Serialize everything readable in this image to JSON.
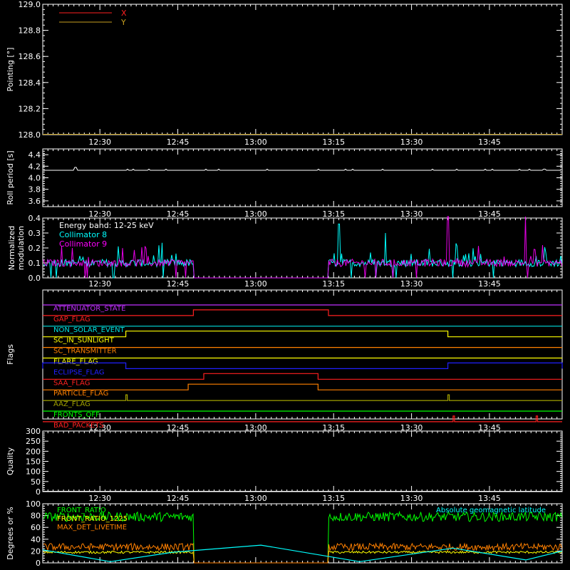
{
  "chart_data": [
    {
      "type": "line",
      "ylabel": "Pointing [°]",
      "ylim": [
        128.0,
        129.0
      ],
      "yticks": [
        "128.0",
        "128.2",
        "128.4",
        "128.6",
        "128.8",
        "129.0"
      ],
      "legend": {
        "placement": "top-left",
        "entries": [
          {
            "name": "X",
            "color": "#ff2020"
          },
          {
            "name": "Y",
            "color": "#c8a020"
          }
        ]
      },
      "series": [
        {
          "name": "X",
          "color": "#ff2020",
          "constant": 128.0
        },
        {
          "name": "Y",
          "color": "#c8a020",
          "constant": 128.0
        }
      ]
    },
    {
      "type": "line",
      "ylabel": "Roll period [s]",
      "ylim": [
        3.5,
        4.5
      ],
      "yticks": [
        "3.6",
        "3.8",
        "4.0",
        "4.2",
        "4.4"
      ],
      "series": [
        {
          "name": "",
          "color": "#ffffff",
          "constant": 4.13
        }
      ]
    },
    {
      "type": "line",
      "ylabel": [
        "Normalized",
        "modulation"
      ],
      "ylim": [
        0.0,
        0.4
      ],
      "yticks": [
        "0.0",
        "0.1",
        "0.2",
        "0.3",
        "0.4"
      ],
      "annotation": "Energy band: 12-25 keV",
      "legend": {
        "placement": "top-left",
        "entries": [
          {
            "name": "Collimator 8",
            "color": "#00ffff"
          },
          {
            "name": "Collimator 9",
            "color": "#ff00ff"
          }
        ]
      },
      "data_gap": [
        "12:48",
        "13:14"
      ],
      "series": [
        {
          "name": "Collimator 8",
          "color": "#00ffff",
          "baseline": 0.1,
          "spikes": [
            {
              "t": "13:16",
              "y": 0.36
            },
            {
              "t": "13:25",
              "y": 0.3
            }
          ]
        },
        {
          "name": "Collimator 9",
          "color": "#ff00ff",
          "baseline": 0.1,
          "spikes": [
            {
              "t": "13:37",
              "y": 0.41
            },
            {
              "t": "13:52",
              "y": 0.41
            }
          ]
        }
      ]
    },
    {
      "type": "line",
      "ylabel": "Flags",
      "flags": [
        {
          "name": "ATTENUATOR_STATE",
          "color": "#c030ff",
          "high": []
        },
        {
          "name": "GAP_FLAG",
          "color": "#ff2020",
          "high": [
            [
              "12:48",
              "13:14"
            ]
          ]
        },
        {
          "name": "NON_SOLAR_EVENT",
          "color": "#00e0e0",
          "high": []
        },
        {
          "name": "SC_IN_SUNLIGHT",
          "color": "#ffff00",
          "high": [
            [
              "12:35",
              "13:37"
            ]
          ]
        },
        {
          "name": "SC_TRANSMITTER",
          "color": "#ff8000",
          "high": []
        },
        {
          "name": "FLARE_FLAG",
          "color": "#ffff00",
          "high": []
        },
        {
          "name": "ECLIPSE_FLAG",
          "color": "#2020ff",
          "high": [
            [
              "12:19",
              "12:35"
            ],
            [
              "13:37",
              "13:59"
            ]
          ]
        },
        {
          "name": "SAA_FLAG",
          "color": "#ff2020",
          "high": [
            [
              "12:50",
              "13:12"
            ]
          ]
        },
        {
          "name": "PARTICLE_FLAG",
          "color": "#ff8000",
          "high": [
            [
              "12:47",
              "13:12"
            ]
          ]
        },
        {
          "name": "AAZ_FLAG",
          "color": "#a0a000",
          "high": [
            [
              "12:35",
              "12:35"
            ],
            [
              "13:37",
              "13:37"
            ]
          ]
        },
        {
          "name": "FRONTS_OFF",
          "color": "#00ff00",
          "high": []
        },
        {
          "name": "BAD_PACKETS",
          "color": "#ff2020",
          "high": [
            [
              "13:38",
              "13:38"
            ],
            [
              "13:54",
              "13:54"
            ]
          ]
        }
      ]
    },
    {
      "type": "line",
      "ylabel": "Quality",
      "ylim": [
        0,
        300
      ],
      "yticks": [
        "0",
        "50",
        "100",
        "150",
        "200",
        "250",
        "300"
      ],
      "series": [
        {
          "name": "",
          "color": "#ffffff",
          "constant": 0
        }
      ]
    },
    {
      "type": "line",
      "ylabel": "Degrees or %",
      "ylim": [
        0,
        100
      ],
      "yticks": [
        "0",
        "20",
        "40",
        "60",
        "80",
        "100"
      ],
      "legend": {
        "placement": "top",
        "entries": [
          {
            "name": "FRONT_RATIO",
            "color": "#00ff00"
          },
          {
            "name": "FRONT_RATIO_1225",
            "color": "#ffff00"
          },
          {
            "name": "MAX_DET_LIVETIME",
            "color": "#ff8000"
          },
          {
            "name": "Absolute geomagnetic latitude",
            "color": "#00ffff"
          }
        ]
      },
      "data_gap": [
        "12:48",
        "13:14"
      ],
      "series": [
        {
          "name": "FRONT_RATIO",
          "color": "#00ff00",
          "level": 78
        },
        {
          "name": "FRONT_RATIO_1225",
          "color": "#ffff00",
          "level": 18
        },
        {
          "name": "MAX_DET_LIVETIME",
          "color": "#ff8000",
          "level": 27
        },
        {
          "name": "Absolute geomagnetic latitude",
          "color": "#00ffff",
          "points": [
            [
              "12:19",
              22
            ],
            [
              "12:32",
              2
            ],
            [
              "12:44",
              18
            ],
            [
              "13:01",
              30
            ],
            [
              "13:20",
              2
            ],
            [
              "13:38",
              25
            ],
            [
              "13:52",
              5
            ],
            [
              "13:59",
              20
            ]
          ]
        }
      ]
    }
  ],
  "time_axis": {
    "start": "12:19",
    "end": "13:59",
    "tick_labels": [
      "12:30",
      "12:45",
      "13:00",
      "13:15",
      "13:30",
      "13:45"
    ]
  }
}
